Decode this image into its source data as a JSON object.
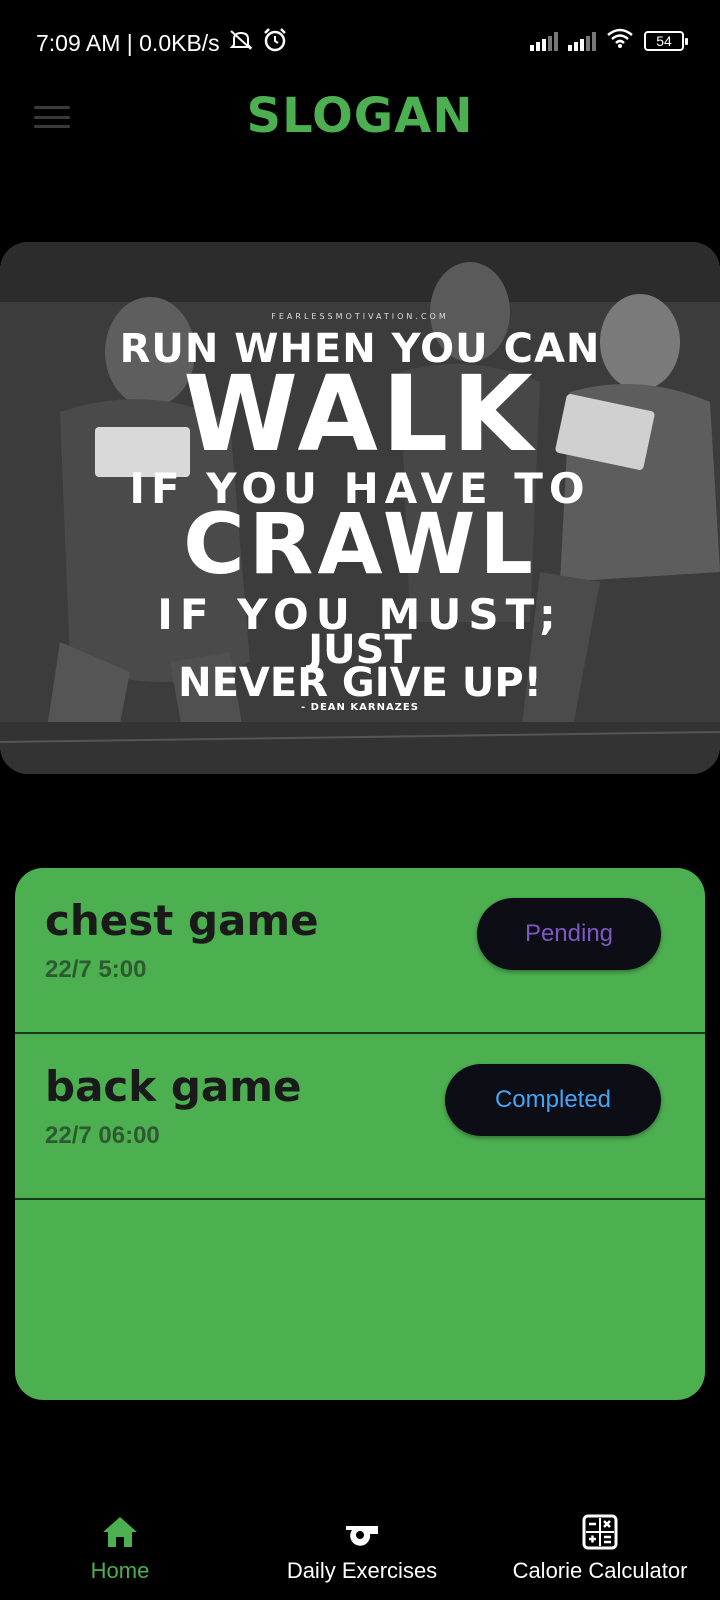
{
  "status_bar": {
    "time_info": "7:09 AM | 0.0KB/s",
    "icons": [
      "mute-icon",
      "alarm-icon",
      "signal-icon",
      "signal-icon",
      "wifi-icon",
      "battery-icon"
    ],
    "battery": "54"
  },
  "app_bar": {
    "title": "SLOGAN",
    "menu_icon": "hamburger-menu-icon",
    "accent": "#4caf50"
  },
  "banner": {
    "site": "FEARLESSMOTIVATION.COM",
    "lines": [
      "RUN WHEN YOU CAN",
      "WALK",
      "IF YOU HAVE TO",
      "CRAWL",
      "IF YOU MUST;",
      "JUST",
      "NEVER GIVE UP!",
      "- DEAN KARNAZES"
    ]
  },
  "workouts": [
    {
      "title": "chest game",
      "time": "22/7 5:00",
      "status": "Pending",
      "status_color": "#7e57c2"
    },
    {
      "title": "back game",
      "time": "22/7 06:00",
      "status": "Completed",
      "status_color": "#42a5f5"
    }
  ],
  "bottom_nav": {
    "items": [
      {
        "label": "Home",
        "icon": "home-icon",
        "active": true
      },
      {
        "label": "Daily Exercises",
        "icon": "whistle-icon",
        "active": false
      },
      {
        "label": "Calorie Calculator",
        "icon": "calculator-icon",
        "active": false
      }
    ]
  }
}
